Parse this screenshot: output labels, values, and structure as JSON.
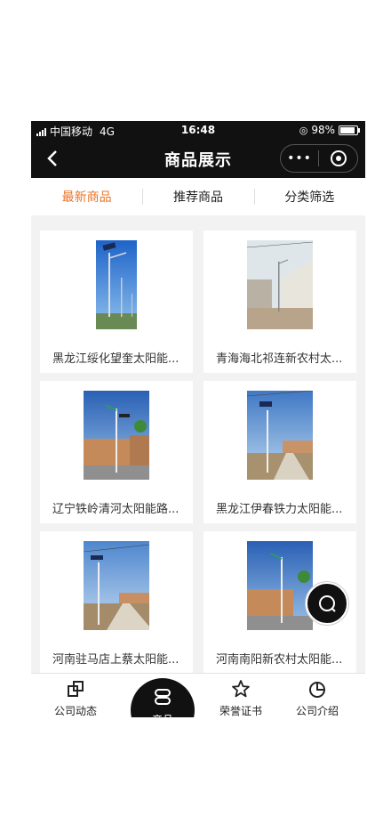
{
  "status_bar": {
    "carrier": "中国移动",
    "network": "4G",
    "time": "16:48",
    "battery": "98%"
  },
  "nav": {
    "title": "商品展示",
    "more_label": "•••"
  },
  "tabs": [
    {
      "label": "最新商品",
      "active": true
    },
    {
      "label": "推荐商品",
      "active": false
    },
    {
      "label": "分类筛选",
      "active": false
    }
  ],
  "products": [
    {
      "name": "黑龙江绥化望奎太阳能..."
    },
    {
      "name": "青海海北祁连新农村太..."
    },
    {
      "name": "辽宁铁岭清河太阳能路..."
    },
    {
      "name": "黑龙江伊春铁力太阳能..."
    },
    {
      "name": "河南驻马店上蔡太阳能..."
    },
    {
      "name": "河南南阳新农村太阳能..."
    }
  ],
  "bottom_nav": [
    {
      "label": "公司动态",
      "icon": "news-icon"
    },
    {
      "label": "产品",
      "icon": "product-icon",
      "active": true
    },
    {
      "label": "荣誉证书",
      "icon": "star-icon"
    },
    {
      "label": "公司介绍",
      "icon": "pie-icon"
    }
  ],
  "colors": {
    "accent": "#e8742a",
    "nav_bg": "#111111",
    "page_bg": "#f2f2f2"
  }
}
